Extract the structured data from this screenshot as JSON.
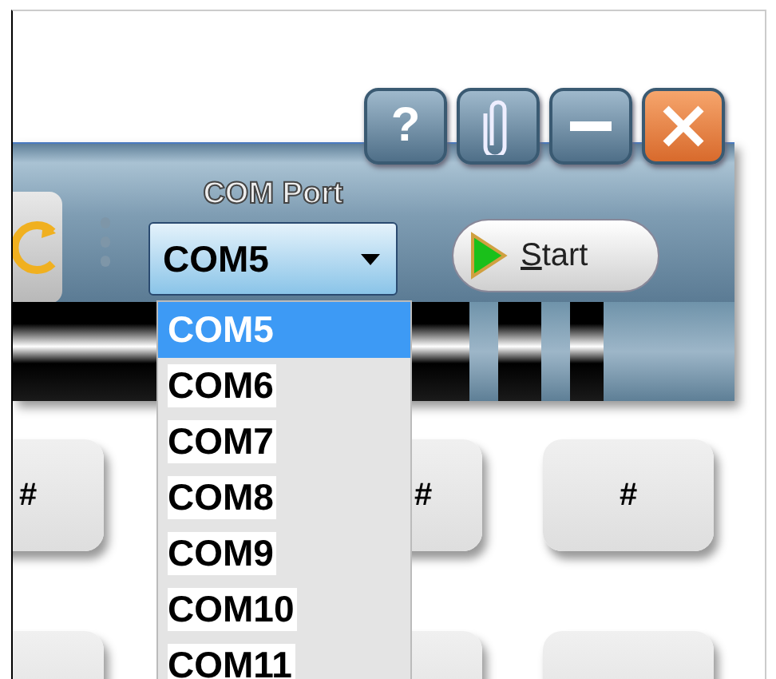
{
  "window_buttons": [
    {
      "kind": "help",
      "label": "?"
    },
    {
      "kind": "attach"
    },
    {
      "kind": "minimize"
    },
    {
      "kind": "close"
    }
  ],
  "toolbar": {
    "com_port_label": "COM Port",
    "com_port": {
      "value": "COM5",
      "expanded": true
    },
    "start_button": {
      "label": "Start",
      "first_letter_underlined": true
    }
  },
  "port_options": [
    {
      "label": "COM5",
      "selected": true
    },
    {
      "label": "COM6",
      "selected": false
    },
    {
      "label": "COM7",
      "selected": false
    },
    {
      "label": "COM8",
      "selected": false
    },
    {
      "label": "COM9",
      "selected": false
    },
    {
      "label": "COM10",
      "selected": false
    },
    {
      "label": "COM11",
      "selected": false
    }
  ],
  "keys": [
    {
      "kind": "labeled",
      "label": "#"
    },
    {
      "kind": "labeled",
      "label": "#"
    },
    {
      "kind": "labeled",
      "label": "#"
    },
    {
      "kind": "blank"
    },
    {
      "kind": "blank"
    },
    {
      "kind": "blank"
    }
  ]
}
